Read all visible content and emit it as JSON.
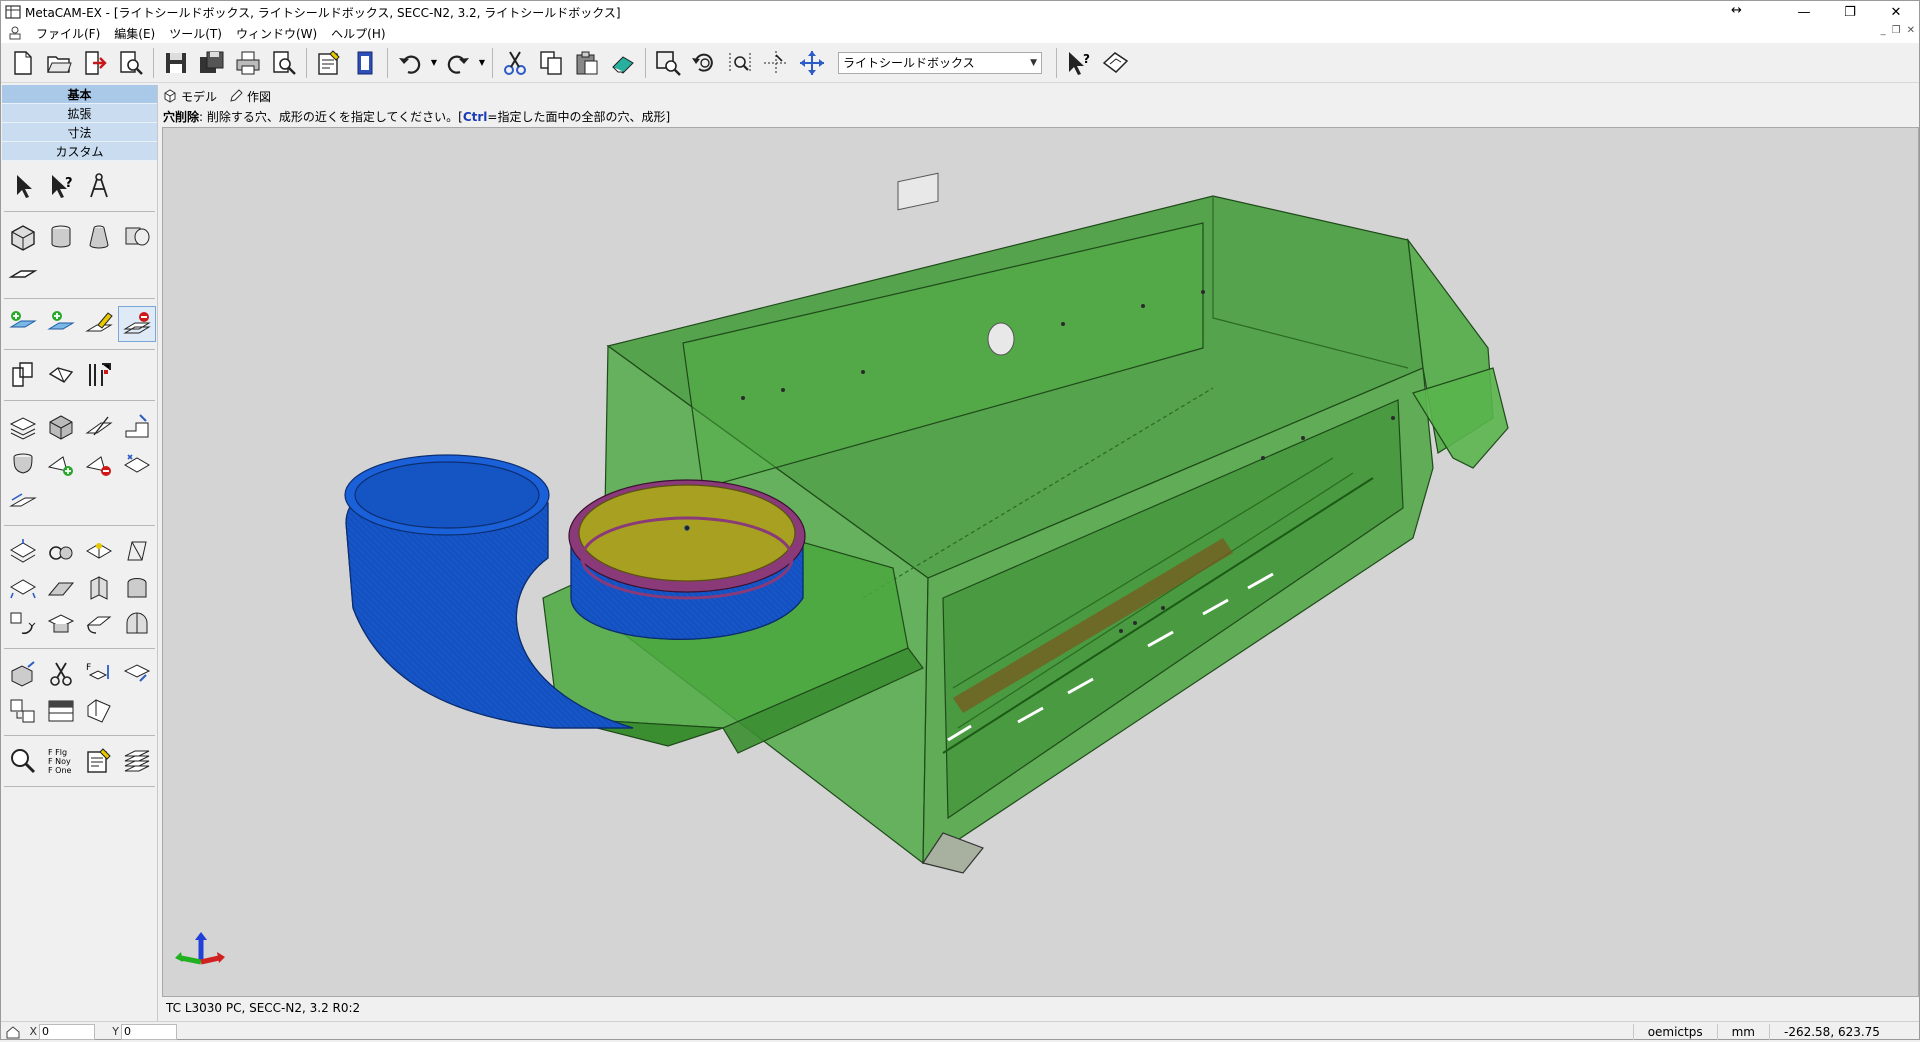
{
  "window": {
    "title": "MetaCAM-EX - [ライトシールドボックス, ライトシールドボックス, SECC-N2, 3.2, ライトシールドボックス]"
  },
  "menu": [
    {
      "label": "ファイル(F)"
    },
    {
      "label": "編集(E)"
    },
    {
      "label": "ツール(T)"
    },
    {
      "label": "ウィンドウ(W)"
    },
    {
      "label": "ヘルプ(H)"
    }
  ],
  "toolbar": {
    "combo_value": "ライトシールドボックス",
    "icons": [
      "new-file-icon",
      "open-folder-icon",
      "export-icon",
      "preview-icon",
      "save-icon",
      "save-all-icon",
      "print-icon",
      "print-preview-icon",
      "properties-icon",
      "sheet-icon",
      "undo-icon",
      "redo-icon",
      "cut-icon",
      "copy-icon",
      "paste-icon",
      "eraser-icon",
      "zoom-window-icon",
      "zoom-previous-icon",
      "zoom-fit-icon",
      "snap-icon",
      "pan-icon",
      "whats-this-icon",
      "manual-icon"
    ]
  },
  "palette": {
    "tabs": [
      {
        "label": "基本",
        "active": true
      },
      {
        "label": "拡張",
        "active": false
      },
      {
        "label": "寸法",
        "active": false
      },
      {
        "label": "カスタム",
        "active": false
      }
    ]
  },
  "view_tabs": [
    {
      "label": "モデル",
      "icon": "cube-icon"
    },
    {
      "label": "作図",
      "icon": "pencil-icon"
    }
  ],
  "hint": {
    "command": "穴削除",
    "text_before": ": 削除する穴、成形の近くを指定してください。[",
    "key": "Ctrl",
    "text_after": "=指定した面中の全部の穴、成形]"
  },
  "status": {
    "part_info": "TC L3030 PC, SECC-N2, 3.2 R0:2",
    "x_label": "X",
    "x_value": "0",
    "y_label": "Y",
    "y_value": "0",
    "mode": "oemictps",
    "unit": "mm",
    "cursor": "-262.58, 623.75"
  },
  "colors": {
    "viewport_bg": "#d4d4d4",
    "sheet_green": "#3f9a35",
    "duct_blue": "#1555c8",
    "flange_yellow": "#a8a020",
    "palette_tab": "#c9dcf0"
  }
}
